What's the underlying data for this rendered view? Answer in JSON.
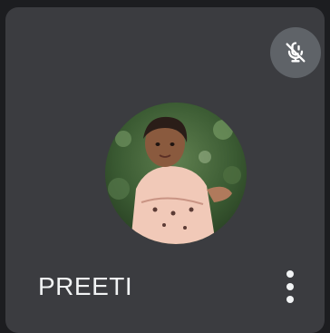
{
  "participant": {
    "name": "PREETI",
    "mic_state": "muted"
  },
  "icons": {
    "mic": "mic-off-icon",
    "more": "more-vertical-icon",
    "avatar": "participant-photo"
  },
  "colors": {
    "tile_bg": "#3b3c40",
    "page_bg": "#1c1d20",
    "mic_button_bg": "#5f6368",
    "text": "#f1f3f4"
  }
}
